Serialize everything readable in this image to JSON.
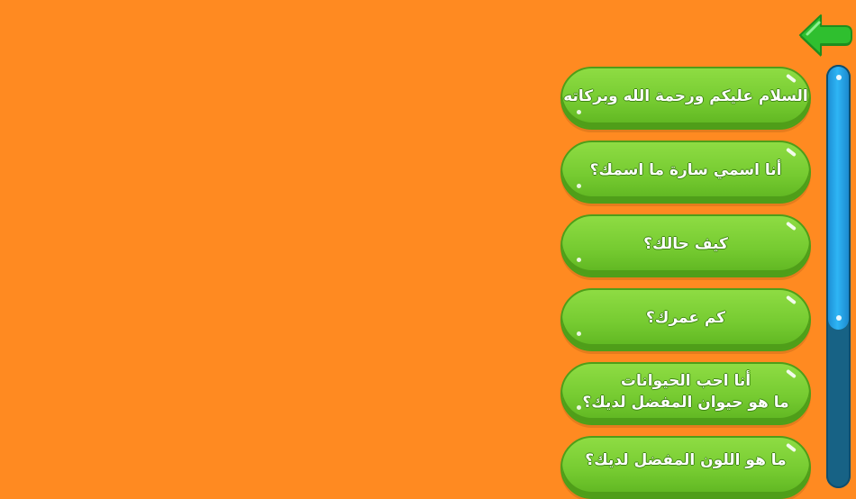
{
  "back_button": {
    "icon": "back-arrow-icon",
    "color": "#2FBF2F"
  },
  "phrases": [
    {
      "lines": [
        "السلام عليكم ورحمة الله وبركاته"
      ]
    },
    {
      "lines": [
        "أنا اسمي سارة ما اسمك؟"
      ]
    },
    {
      "lines": [
        "كيف حالك؟"
      ]
    },
    {
      "lines": [
        "كم عمرك؟"
      ]
    },
    {
      "lines": [
        "أنا احب الحيوانات",
        "ما هو حيوان المفضل لديك؟"
      ]
    },
    {
      "lines": [
        "ما هو اللون المفضل لديك؟"
      ]
    }
  ],
  "scrollbar": {
    "position": 0.0,
    "visible_fraction": 0.62
  },
  "colors": {
    "background": "#FF8A21",
    "button": "#76CB31",
    "scroll_track": "#176285",
    "scroll_thumb": "#2EB5F5"
  }
}
